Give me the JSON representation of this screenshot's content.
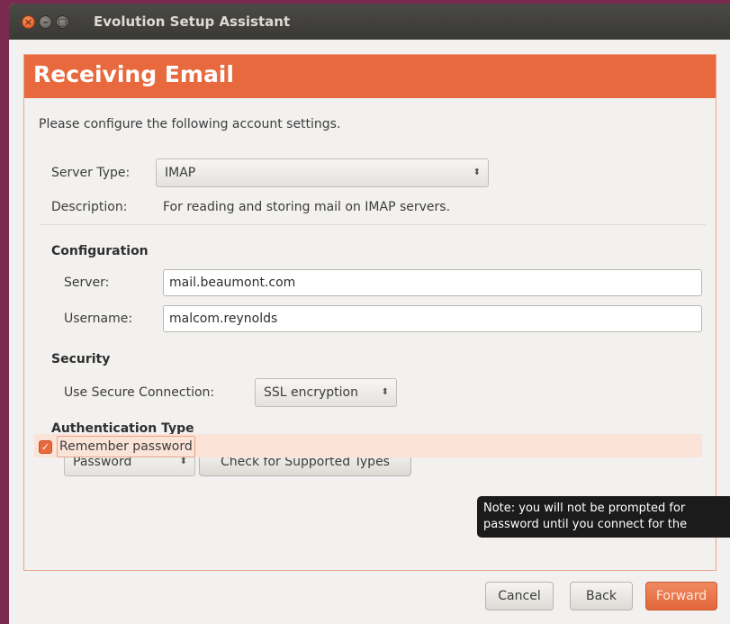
{
  "window": {
    "title": "Evolution Setup Assistant",
    "controls": {
      "close": "×",
      "minimize": "–",
      "maximize": "□"
    }
  },
  "page": {
    "title": "Receiving Email",
    "intro": "Please configure the following account settings."
  },
  "server_type": {
    "label": "Server Type:",
    "value": "IMAP",
    "description_label": "Description:",
    "description": "For reading and storing mail on IMAP servers."
  },
  "configuration": {
    "heading": "Configuration",
    "server_label": "Server:",
    "server_value": "mail.beaumont.com",
    "username_label": "Username:",
    "username_value": "malcom.reynolds"
  },
  "security": {
    "heading": "Security",
    "label": "Use Secure Connection:",
    "value": "SSL encryption"
  },
  "authentication": {
    "heading": "Authentication Type",
    "type_value": "Password",
    "check_button": "Check for Supported Types",
    "remember_label": "Remember password",
    "remember_checked": true
  },
  "tooltip": {
    "line1": "Note: you will not be prompted for",
    "line2": "password until you connect for the"
  },
  "footer": {
    "cancel": "Cancel",
    "back": "Back",
    "forward": "Forward"
  },
  "icons": {
    "combo_arrow": "⬍",
    "check": "✓"
  },
  "colors": {
    "accent": "#e8693d",
    "titlebar": "#3c3b37",
    "tooltip_bg": "#1b1b1b"
  }
}
